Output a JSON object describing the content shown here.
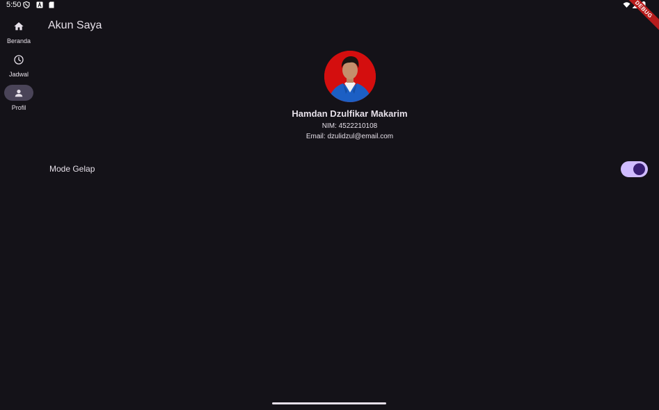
{
  "status_bar": {
    "time": "5:50",
    "left_icons": [
      "shield-icon",
      "a-box-icon",
      "sd-card-icon"
    ],
    "right_icons": [
      "wifi-icon",
      "signal-icon",
      "battery-icon"
    ]
  },
  "debug_banner": "DEBUG",
  "nav_rail": {
    "items": [
      {
        "label": "Beranda",
        "icon": "home-icon",
        "selected": false
      },
      {
        "label": "Jadwal",
        "icon": "clock-icon",
        "selected": false
      },
      {
        "label": "Profil",
        "icon": "person-icon",
        "selected": true
      }
    ]
  },
  "app_bar": {
    "title": "Akun Saya"
  },
  "profile": {
    "name": "Hamdan Dzulfikar Makarim",
    "nim": "NIM: 4522210108",
    "email": "Email: dzulidzul@email.com"
  },
  "settings": {
    "dark_mode": {
      "label": "Mode Gelap",
      "enabled": true
    }
  },
  "colors": {
    "background": "#141218",
    "on_surface": "#e6e0e9",
    "nav_indicator": "#4a4458",
    "switch_track": "#d0bcff",
    "switch_thumb": "#381e72",
    "avatar_bg": "#d40e0e"
  }
}
